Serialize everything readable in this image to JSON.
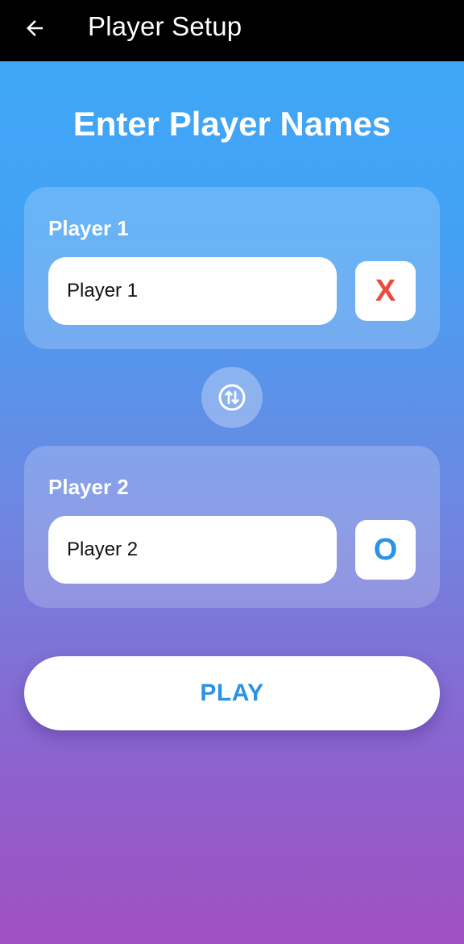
{
  "appbar": {
    "title": "Player Setup",
    "back_icon": "arrow-left-icon"
  },
  "heading": "Enter Player Names",
  "players": [
    {
      "label": "Player 1",
      "name_value": "Player 1",
      "symbol": "X",
      "symbol_color": "#e74c3c"
    },
    {
      "label": "Player 2",
      "name_value": "Player 2",
      "symbol": "O",
      "symbol_color": "#2b93e6"
    }
  ],
  "swap_icon": "swap-vertical-icon",
  "play_label": "PLAY",
  "colors": {
    "accent": "#2b93e6",
    "x_symbol": "#e74c3c",
    "gradient_top": "#3fa9f8",
    "gradient_bottom": "#a050c0",
    "appbar": "#000000"
  }
}
